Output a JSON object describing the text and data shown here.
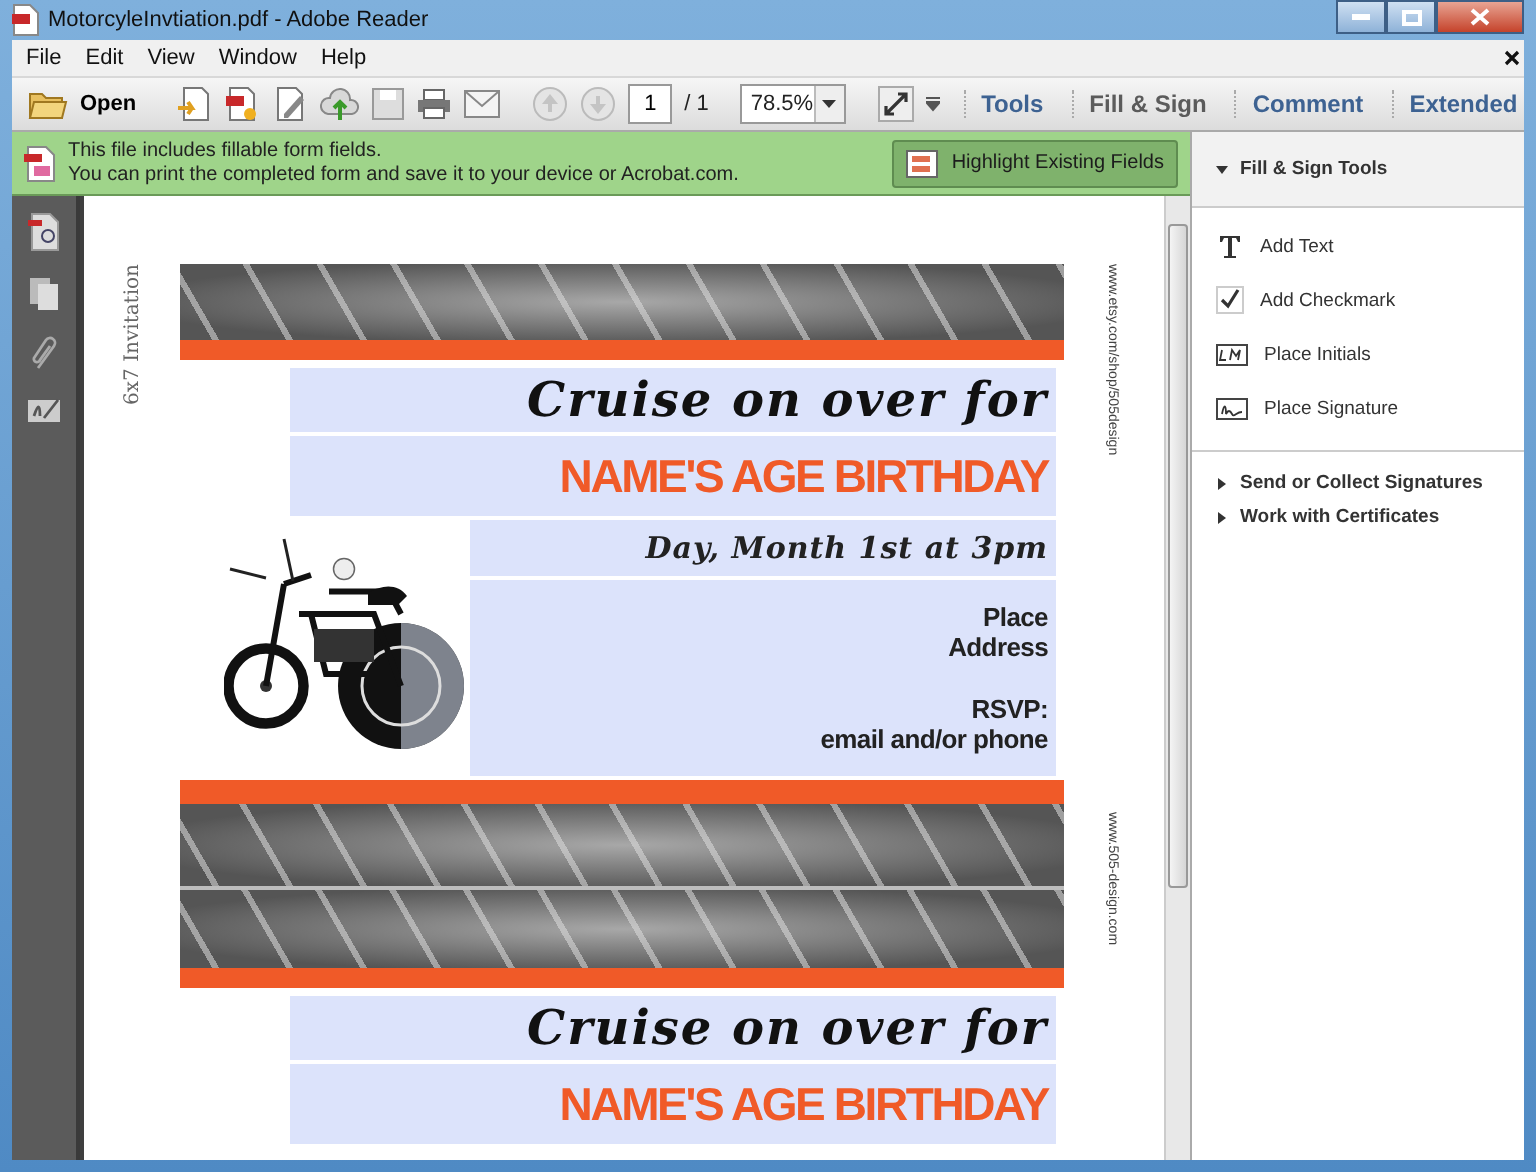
{
  "window": {
    "title": "MotorcyleInvtiation.pdf - Adobe Reader"
  },
  "menu": [
    "File",
    "Edit",
    "View",
    "Window",
    "Help"
  ],
  "toolbar": {
    "open_label": "Open",
    "page_number": "1",
    "page_total": "/ 1",
    "zoom": "78.5%",
    "tabs": [
      {
        "label": "Tools",
        "selected": false
      },
      {
        "label": "Fill & Sign",
        "selected": true
      },
      {
        "label": "Comment",
        "selected": false
      },
      {
        "label": "Extended",
        "selected": false
      }
    ]
  },
  "notification": {
    "lines": [
      "This file includes fillable form fields.",
      "You can print the completed form and save it to your device or Acrobat.com."
    ],
    "button": "Highlight Existing Fields"
  },
  "panel": {
    "header": "Fill & Sign Tools",
    "expanded": true,
    "tools": [
      {
        "kind": "text",
        "label": "Add Text"
      },
      {
        "kind": "checkmark",
        "label": "Add Checkmark"
      },
      {
        "kind": "initials",
        "label": "Place Initials"
      },
      {
        "kind": "signature",
        "label": "Place Signature"
      }
    ],
    "sections": [
      {
        "label": "Send or Collect Signatures",
        "expanded": false
      },
      {
        "label": "Work with Certificates",
        "expanded": false
      }
    ]
  },
  "document": {
    "side_label": "6x7 Invitation",
    "margin_texts": [
      "www.etsy.com/shop/505design",
      "www.505-design.com"
    ],
    "invitations": [
      {
        "headline": "Cruise on over for",
        "name_line": "NAME'S AGE BIRTHDAY",
        "date_line": "Day, Month 1st at 3pm",
        "place": "Place",
        "address": "Address",
        "rsvp": "RSVP:",
        "contact": "email and/or phone"
      },
      {
        "headline": "Cruise on over for",
        "name_line": "NAME'S AGE BIRTHDAY"
      }
    ]
  }
}
